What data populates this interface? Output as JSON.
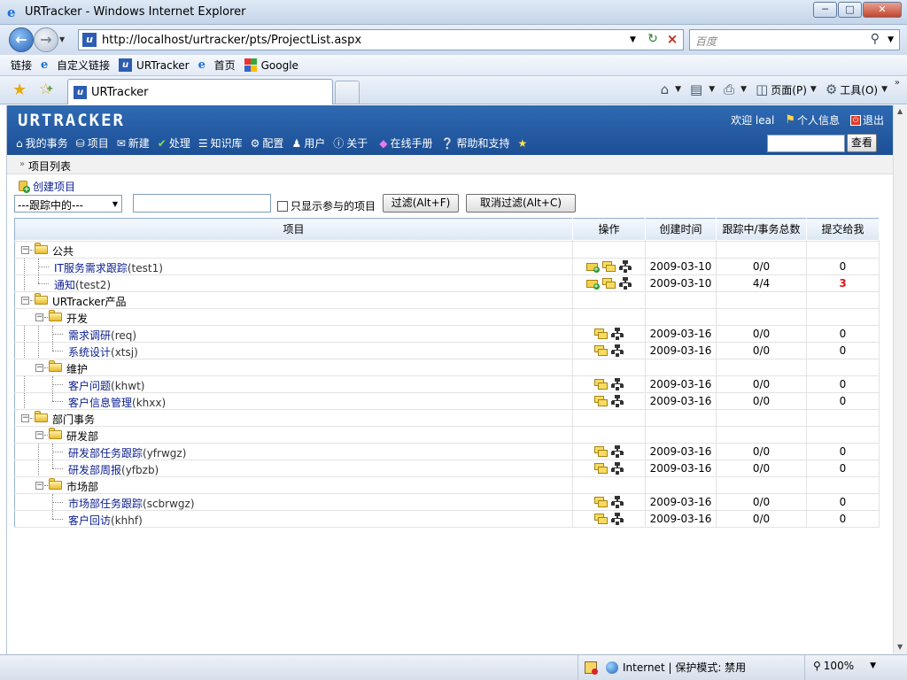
{
  "window": {
    "title": "URTracker - Windows Internet Explorer",
    "minimize": "─",
    "maximize": "□",
    "close": "✕"
  },
  "address": {
    "url": "http://localhost/urtracker/pts/ProjectList.aspx",
    "search_placeholder": "百度"
  },
  "links_bar": {
    "label": "链接",
    "items": [
      {
        "label": "自定义链接",
        "icon": "ie-icon"
      },
      {
        "label": "URTracker",
        "icon": "urtracker-icon"
      },
      {
        "label": "首页",
        "icon": "ie-icon"
      },
      {
        "label": "Google",
        "icon": "google-icon"
      }
    ]
  },
  "tab": {
    "title": "URTracker"
  },
  "command_bar": {
    "page": "页面(P)",
    "tools": "工具(O)"
  },
  "app": {
    "brand": "URTRACKER",
    "welcome": "欢迎 leal",
    "profile": "个人信息",
    "logout": "退出",
    "menu": [
      {
        "label": "我的事务",
        "icon": "home-icon"
      },
      {
        "label": "项目",
        "icon": "database-icon"
      },
      {
        "label": "新建",
        "icon": "new-icon"
      },
      {
        "label": "处理",
        "icon": "check-icon"
      },
      {
        "label": "知识库",
        "icon": "books-icon"
      },
      {
        "label": "配置",
        "icon": "gear-icon"
      },
      {
        "label": "用户",
        "icon": "users-icon"
      },
      {
        "label": "关于",
        "icon": "info-icon"
      },
      {
        "label": "在线手册",
        "icon": "manual-icon"
      },
      {
        "label": "帮助和支持",
        "icon": "help-icon"
      },
      {
        "label": "",
        "icon": "star-icon"
      }
    ],
    "search_button": "查看"
  },
  "breadcrumb": {
    "current": "项目列表"
  },
  "actions": {
    "create_project": "创建项目"
  },
  "filter": {
    "select_value": "---跟踪中的---",
    "text_value": "",
    "only_mine_label": "只显示参与的项目",
    "filter_button": "过滤(Alt+F)",
    "cancel_button": "取消过滤(Alt+C)"
  },
  "table": {
    "headers": [
      "项目",
      "操作",
      "创建时间",
      "跟踪中/事务总数",
      "提交给我"
    ],
    "rows": [
      {
        "type": "group",
        "level": 0,
        "name": "公共"
      },
      {
        "type": "project",
        "level": 1,
        "name": "IT服务需求跟踪",
        "code": "(test1)",
        "ops": [
          "new",
          "list",
          "sitemap"
        ],
        "created": "2009-03-10",
        "tracking": "0/0",
        "submitted": "0",
        "highlight": false,
        "last": false
      },
      {
        "type": "project",
        "level": 1,
        "name": "通知",
        "code": "(test2)",
        "ops": [
          "new",
          "list",
          "sitemap"
        ],
        "created": "2009-03-10",
        "tracking": "4/4",
        "submitted": "3",
        "highlight": true,
        "last": true
      },
      {
        "type": "group",
        "level": 0,
        "name": "URTracker产品"
      },
      {
        "type": "group",
        "level": 1,
        "name": "开发"
      },
      {
        "type": "project",
        "level": 2,
        "name": "需求调研",
        "code": "(req)",
        "ops": [
          "list",
          "sitemap"
        ],
        "created": "2009-03-16",
        "tracking": "0/0",
        "submitted": "0",
        "highlight": false,
        "last": false
      },
      {
        "type": "project",
        "level": 2,
        "name": "系统设计",
        "code": "(xtsj)",
        "ops": [
          "list",
          "sitemap"
        ],
        "created": "2009-03-16",
        "tracking": "0/0",
        "submitted": "0",
        "highlight": false,
        "last": true
      },
      {
        "type": "group",
        "level": 1,
        "name": "维护"
      },
      {
        "type": "project",
        "level": 2,
        "name": "客户问题",
        "code": "(khwt)",
        "ops": [
          "list",
          "sitemap"
        ],
        "created": "2009-03-16",
        "tracking": "0/0",
        "submitted": "0",
        "highlight": false,
        "last": false
      },
      {
        "type": "project",
        "level": 2,
        "name": "客户信息管理",
        "code": "(khxx)",
        "ops": [
          "list",
          "sitemap"
        ],
        "created": "2009-03-16",
        "tracking": "0/0",
        "submitted": "0",
        "highlight": false,
        "last": true
      },
      {
        "type": "group",
        "level": 0,
        "name": "部门事务"
      },
      {
        "type": "group",
        "level": 1,
        "name": "研发部"
      },
      {
        "type": "project",
        "level": 2,
        "name": "研发部任务跟踪",
        "code": "(yfrwgz)",
        "ops": [
          "list",
          "sitemap"
        ],
        "created": "2009-03-16",
        "tracking": "0/0",
        "submitted": "0",
        "highlight": false,
        "last": false
      },
      {
        "type": "project",
        "level": 2,
        "name": "研发部周报",
        "code": "(yfbzb)",
        "ops": [
          "list",
          "sitemap"
        ],
        "created": "2009-03-16",
        "tracking": "0/0",
        "submitted": "0",
        "highlight": false,
        "last": true
      },
      {
        "type": "group",
        "level": 1,
        "name": "市场部"
      },
      {
        "type": "project",
        "level": 2,
        "name": "市场部任务跟踪",
        "code": "(scbrwgz)",
        "ops": [
          "list",
          "sitemap"
        ],
        "created": "2009-03-16",
        "tracking": "0/0",
        "submitted": "0",
        "highlight": false,
        "last": false
      },
      {
        "type": "project",
        "level": 2,
        "name": "客户回访",
        "code": "(khhf)",
        "ops": [
          "list",
          "sitemap"
        ],
        "created": "2009-03-16",
        "tracking": "0/0",
        "submitted": "0",
        "highlight": false,
        "last": true
      }
    ]
  },
  "status_bar": {
    "zone": "Internet | 保护模式: 禁用",
    "zoom": "100%"
  },
  "colors": {
    "app_header": "#2a62aa",
    "link": "#0a1d8f",
    "alert": "#d41818"
  }
}
